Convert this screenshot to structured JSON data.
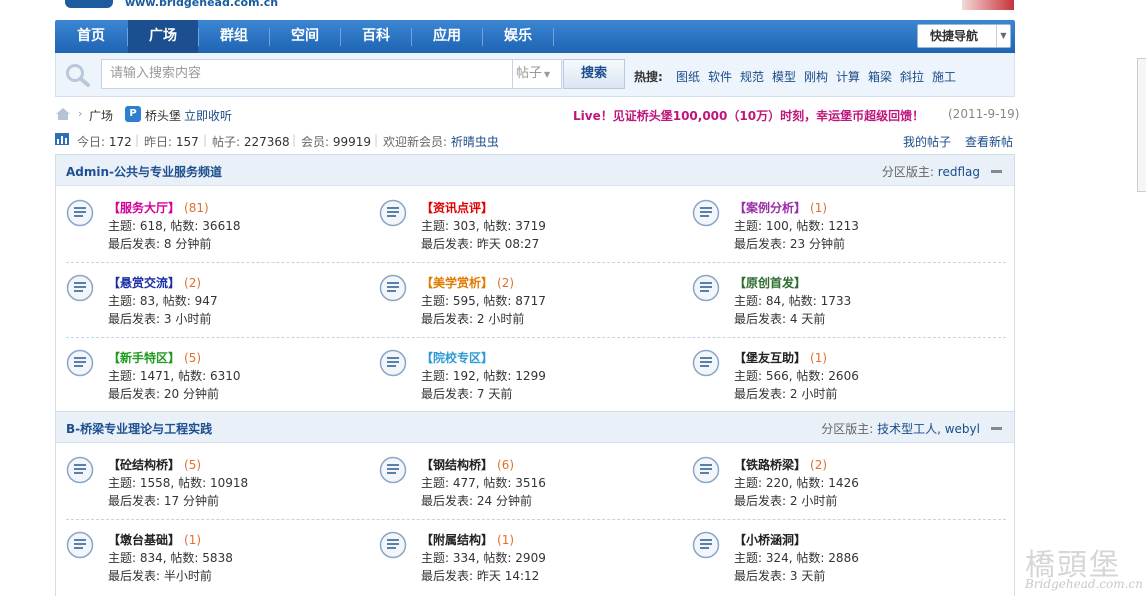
{
  "header": {
    "logo_url_text": "www.bridgehead.com.cn"
  },
  "nav": {
    "items": [
      "首页",
      "广场",
      "群组",
      "空间",
      "百科",
      "应用",
      "娱乐"
    ],
    "active": "广场",
    "quick_nav_label": "快捷导航"
  },
  "search": {
    "placeholder": "请输入搜索内容",
    "type_value": "帖子",
    "button_label": "搜索",
    "hot_label": "热搜:",
    "hot_items": [
      "图纸",
      "软件",
      "规范",
      "模型",
      "刚构",
      "计算",
      "箱梁",
      "斜拉",
      "施工"
    ]
  },
  "breadcrumb": {
    "level1": "广场",
    "level2": "桥头堡",
    "collect": "立即收听",
    "live_text": "Live！见证桥头堡100,000（10万）时刻，幸运堡币超级回馈！",
    "live_date": "(2011-9-19)"
  },
  "stats": {
    "today_label": "今日:",
    "today": "172",
    "yesterday_label": "昨日:",
    "yesterday": "157",
    "posts_label": "帖子:",
    "posts": "227368",
    "members_label": "会员:",
    "members": "99919",
    "welcome_label": "欢迎新会员:",
    "new_member": "祈晴虫虫",
    "my_posts": "我的帖子",
    "new_posts": "查看新帖"
  },
  "sections": [
    {
      "title": "Admin-公共与专业服务频道",
      "mods_label": "分区版主:",
      "mods": "redflag",
      "forums": [
        {
          "name": "【服务大厅】",
          "color": "#d4009a",
          "count": "(81)",
          "topics_label": "主题:",
          "topics": "618",
          "posts_label": "帖数:",
          "posts": "36618",
          "last_label": "最后发表:",
          "last": "8 分钟前"
        },
        {
          "name": "【资讯点评】",
          "color": "#e00000",
          "count": "",
          "topics_label": "主题:",
          "topics": "303",
          "posts_label": "帖数:",
          "posts": "3719",
          "last_label": "最后发表:",
          "last": "昨天 08:27"
        },
        {
          "name": "【案例分析】",
          "color": "#9a2ea6",
          "count": "(1)",
          "topics_label": "主题:",
          "topics": "100",
          "posts_label": "帖数:",
          "posts": "1213",
          "last_label": "最后发表:",
          "last": "23 分钟前"
        },
        {
          "name": "【悬赏交流】",
          "color": "#1a2ea6",
          "count": "(2)",
          "topics_label": "主题:",
          "topics": "83",
          "posts_label": "帖数:",
          "posts": "947",
          "last_label": "最后发表:",
          "last": "3 小时前"
        },
        {
          "name": "【美学赏析】",
          "color": "#e07a00",
          "count": "(2)",
          "topics_label": "主题:",
          "topics": "595",
          "posts_label": "帖数:",
          "posts": "8717",
          "last_label": "最后发表:",
          "last": "2 小时前"
        },
        {
          "name": "【原创首发】",
          "color": "#2e6b2e",
          "count": "",
          "topics_label": "主题:",
          "topics": "84",
          "posts_label": "帖数:",
          "posts": "1733",
          "last_label": "最后发表:",
          "last": "4 天前"
        },
        {
          "name": "【新手特区】",
          "color": "#1f9a1f",
          "count": "(5)",
          "topics_label": "主题:",
          "topics": "1471",
          "posts_label": "帖数:",
          "posts": "6310",
          "last_label": "最后发表:",
          "last": "20 分钟前"
        },
        {
          "name": "【院校专区】",
          "color": "#2e9ad4",
          "count": "",
          "topics_label": "主题:",
          "topics": "192",
          "posts_label": "帖数:",
          "posts": "1299",
          "last_label": "最后发表:",
          "last": "7 天前"
        },
        {
          "name": "【堡友互助】",
          "color": "#222222",
          "count": "(1)",
          "topics_label": "主题:",
          "topics": "566",
          "posts_label": "帖数:",
          "posts": "2606",
          "last_label": "最后发表:",
          "last": "2 小时前"
        }
      ]
    },
    {
      "title": "B-桥梁专业理论与工程实践",
      "mods_label": "分区版主:",
      "mods": "技术型工人, webyl",
      "forums": [
        {
          "name": "【砼结构桥】",
          "color": "#222222",
          "count": "(5)",
          "topics_label": "主题:",
          "topics": "1558",
          "posts_label": "帖数:",
          "posts": "10918",
          "last_label": "最后发表:",
          "last": "17 分钟前"
        },
        {
          "name": "【钢结构桥】",
          "color": "#222222",
          "count": "(6)",
          "topics_label": "主题:",
          "topics": "477",
          "posts_label": "帖数:",
          "posts": "3516",
          "last_label": "最后发表:",
          "last": "24 分钟前"
        },
        {
          "name": "【铁路桥梁】",
          "color": "#222222",
          "count": "(2)",
          "topics_label": "主题:",
          "topics": "220",
          "posts_label": "帖数:",
          "posts": "1426",
          "last_label": "最后发表:",
          "last": "2 小时前"
        },
        {
          "name": "【墩台基础】",
          "color": "#222222",
          "count": "(1)",
          "topics_label": "主题:",
          "topics": "834",
          "posts_label": "帖数:",
          "posts": "5838",
          "last_label": "最后发表:",
          "last": "半小时前"
        },
        {
          "name": "【附属结构】",
          "color": "#222222",
          "count": "(1)",
          "topics_label": "主题:",
          "topics": "334",
          "posts_label": "帖数:",
          "posts": "2909",
          "last_label": "最后发表:",
          "last": "昨天 14:12"
        },
        {
          "name": "【小桥涵洞】",
          "color": "#222222",
          "count": "",
          "topics_label": "主题:",
          "topics": "324",
          "posts_label": "帖数:",
          "posts": "2886",
          "last_label": "最后发表:",
          "last": "3 天前"
        }
      ]
    }
  ],
  "watermark": {
    "cn": "橋頭堡",
    "en": "Bridgehead.com.cn"
  },
  "colors": {
    "nav_blue": "#1e64b3",
    "nav_active": "#1c4f8f",
    "link_blue": "#1a4c8a",
    "live_magenta": "#c0157b",
    "count_orange": "#e07030"
  }
}
